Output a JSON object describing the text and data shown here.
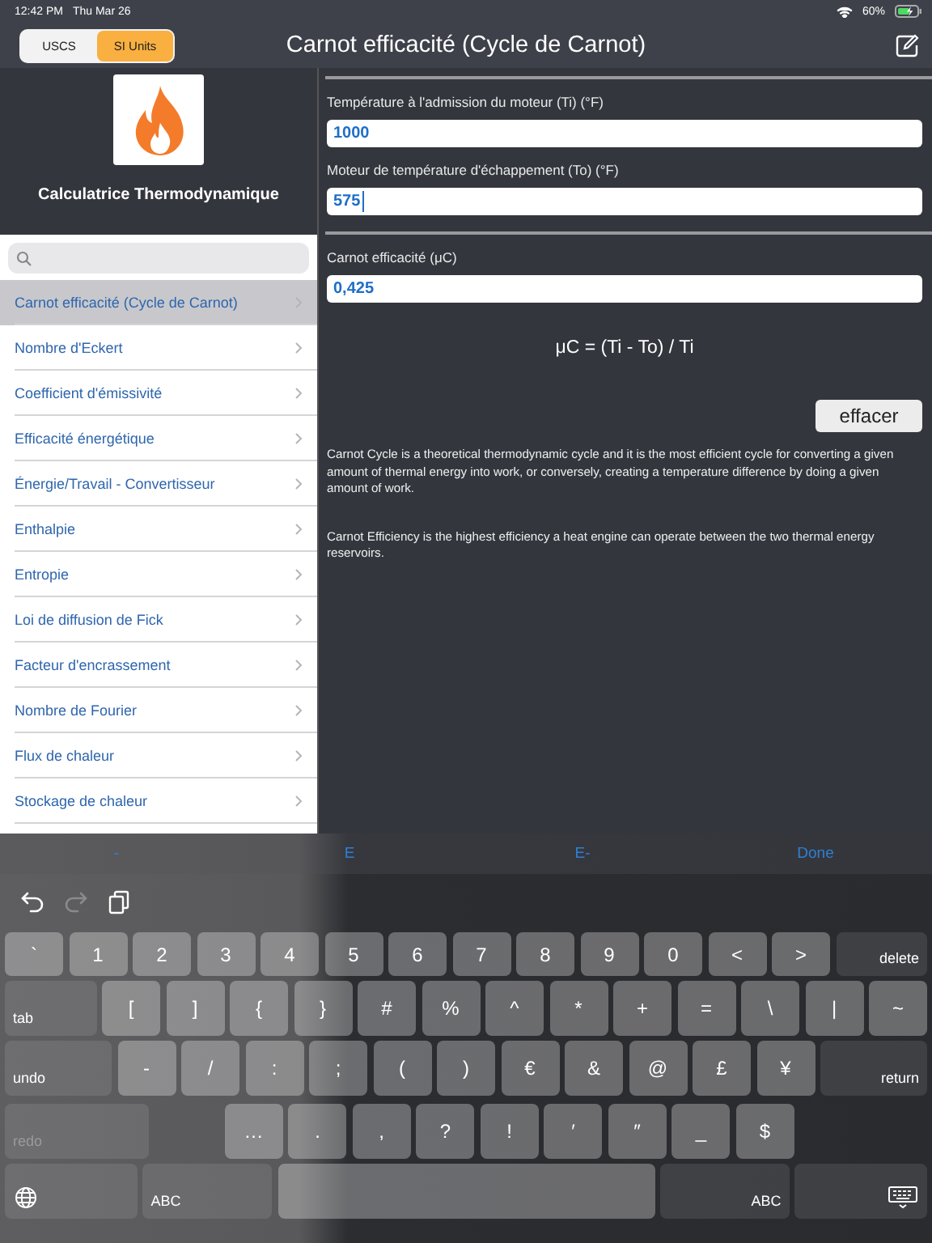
{
  "status_bar": {
    "time": "12:42 PM",
    "date": "Thu Mar 26",
    "battery": "60%"
  },
  "nav": {
    "segments": [
      {
        "label": "USCS",
        "selected": false
      },
      {
        "label": "SI Units",
        "selected": true
      }
    ],
    "title": "Carnot efficacité (Cycle de Carnot)"
  },
  "sidebar": {
    "app_title": "Calculatrice Thermodynamique",
    "items": [
      {
        "label": "Carnot efficacité (Cycle de Carnot)",
        "selected": true
      },
      {
        "label": "Nombre d'Eckert",
        "selected": false
      },
      {
        "label": "Coefficient d'émissivité",
        "selected": false
      },
      {
        "label": "Efficacité énergétique",
        "selected": false
      },
      {
        "label": "Énergie/Travail - Convertisseur",
        "selected": false
      },
      {
        "label": "Enthalpie",
        "selected": false
      },
      {
        "label": "Entropie",
        "selected": false
      },
      {
        "label": "Loi de diffusion de Fick",
        "selected": false
      },
      {
        "label": "Facteur d'encrassement",
        "selected": false
      },
      {
        "label": "Nombre de Fourier",
        "selected": false
      },
      {
        "label": "Flux de chaleur",
        "selected": false
      },
      {
        "label": "Stockage de chaleur",
        "selected": false
      }
    ]
  },
  "calculator": {
    "inputs": [
      {
        "label": "Température à l'admission du moteur (Ti) (°F)",
        "value": "1000",
        "focused": false
      },
      {
        "label": "Moteur de température d'échappement (To) (°F)",
        "value": "575",
        "focused": true
      }
    ],
    "result": {
      "label": "Carnot efficacité (μC)",
      "value": "0,425"
    },
    "formula": "μC = (Ti - To) / Ti",
    "clear_button": "effacer",
    "descriptions": [
      "Carnot Cycle is a theoretical thermodynamic cycle and it is the most efficient cycle for converting a given amount of thermal energy into work, or conversely, creating a temperature difference by doing a given amount of work.",
      "Carnot Efficiency is the highest efficiency a heat engine can operate between the two thermal energy reservoirs."
    ]
  },
  "keyboard": {
    "accessory": [
      "-",
      "E",
      "E-",
      "Done"
    ],
    "toolbar": [
      {
        "kind": "undo",
        "disabled": false
      },
      {
        "kind": "redo",
        "disabled": true
      },
      {
        "kind": "paste",
        "disabled": false
      }
    ],
    "rows": [
      {
        "keys": [
          {
            "kind": "char",
            "label": "`"
          },
          {
            "kind": "char",
            "label": "1"
          },
          {
            "kind": "char",
            "label": "2"
          },
          {
            "kind": "char",
            "label": "3"
          },
          {
            "kind": "char",
            "label": "4"
          },
          {
            "kind": "char",
            "label": "5"
          },
          {
            "kind": "char",
            "label": "6"
          },
          {
            "kind": "char",
            "label": "7"
          },
          {
            "kind": "char",
            "label": "8"
          },
          {
            "kind": "char",
            "label": "9"
          },
          {
            "kind": "char",
            "label": "0"
          },
          {
            "kind": "char",
            "label": "<"
          },
          {
            "kind": "char",
            "label": ">"
          },
          {
            "kind": "modright",
            "label": "delete"
          }
        ]
      },
      {
        "keys": [
          {
            "kind": "modleft",
            "label": "tab"
          },
          {
            "kind": "char",
            "label": "["
          },
          {
            "kind": "char",
            "label": "]"
          },
          {
            "kind": "char",
            "label": "{"
          },
          {
            "kind": "char",
            "label": "}"
          },
          {
            "kind": "char",
            "label": "#"
          },
          {
            "kind": "char",
            "label": "%"
          },
          {
            "kind": "char",
            "label": "^"
          },
          {
            "kind": "char",
            "label": "*"
          },
          {
            "kind": "char",
            "label": "+"
          },
          {
            "kind": "char",
            "label": "="
          },
          {
            "kind": "char",
            "label": "\\"
          },
          {
            "kind": "char",
            "label": "|"
          },
          {
            "kind": "char",
            "label": "~"
          }
        ]
      },
      {
        "keys": [
          {
            "kind": "modleft",
            "label": "undo"
          },
          {
            "kind": "char",
            "label": "-"
          },
          {
            "kind": "char",
            "label": "/"
          },
          {
            "kind": "char",
            "label": ":"
          },
          {
            "kind": "char",
            "label": ";"
          },
          {
            "kind": "char",
            "label": "("
          },
          {
            "kind": "char",
            "label": ")"
          },
          {
            "kind": "char",
            "label": "€"
          },
          {
            "kind": "char",
            "label": "&"
          },
          {
            "kind": "char",
            "label": "@"
          },
          {
            "kind": "char",
            "label": "£"
          },
          {
            "kind": "char",
            "label": "¥"
          },
          {
            "kind": "modright",
            "label": "return"
          }
        ]
      },
      {
        "keys": [
          {
            "kind": "modleft",
            "label": "redo",
            "disabled": true
          },
          {
            "kind": "gap"
          },
          {
            "kind": "char",
            "label": "…"
          },
          {
            "kind": "char",
            "label": "."
          },
          {
            "kind": "char",
            "label": ","
          },
          {
            "kind": "char",
            "label": "?"
          },
          {
            "kind": "char",
            "label": "!"
          },
          {
            "kind": "char",
            "label": "′"
          },
          {
            "kind": "char",
            "label": "″"
          },
          {
            "kind": "char",
            "label": "_"
          },
          {
            "kind": "char",
            "label": "$"
          },
          {
            "kind": "trail"
          }
        ]
      },
      {
        "keys": [
          {
            "kind": "globe"
          },
          {
            "kind": "modleft",
            "label": "ABC"
          },
          {
            "kind": "space"
          },
          {
            "kind": "modright",
            "label": "ABC"
          },
          {
            "kind": "hide"
          }
        ]
      }
    ]
  }
}
